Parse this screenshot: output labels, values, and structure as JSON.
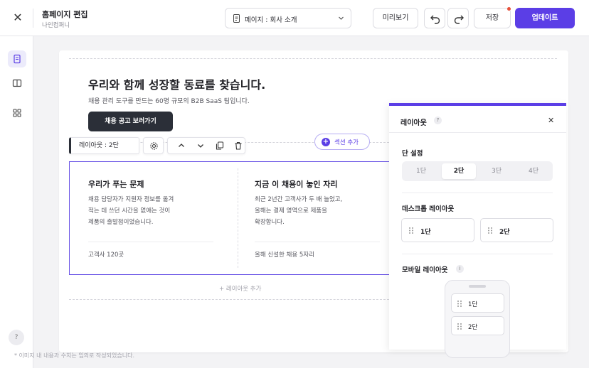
{
  "topbar": {
    "title": "홈페이지 편집",
    "subtitle": "나인컴퍼니",
    "page_select": "페이지 : 회사 소개",
    "preview": "미리보기",
    "save": "저장",
    "update": "업데이트"
  },
  "hero": {
    "title": "우리와 함께 성장할 동료를 찾습니다.",
    "desc": "채용 관리 도구를 만드는 60명 규모의 B2B SaaS 팀입니다.",
    "cta": "채용 공고 보러가기"
  },
  "add_section": "섹션 추가",
  "layout_label": "레이아웃 : 2단",
  "columns": [
    {
      "title": "우리가 푸는 문제",
      "lines": [
        "채용 담당자가 지원자 정보를 옮겨",
        "적는 데 쓰던 시간을 없애는 것이",
        "제품의 출발점이었습니다."
      ],
      "footer": "고객사 120곳"
    },
    {
      "title": "지금 이 채용이 놓인 자리",
      "lines": [
        "최근 2년간 고객사가 두 배 늘었고,",
        "올해는 결제 영역으로 제품을",
        "확장합니다."
      ],
      "footer": "올해 신설한 채용 5자리"
    }
  ],
  "add_layout": "+ 레이아웃 추가",
  "panel": {
    "title": "레이아웃",
    "help": "?",
    "close": "✕",
    "columns_label": "단 설정",
    "column_options": [
      "1단",
      "2단",
      "3단",
      "4단"
    ],
    "selected_column": "2단",
    "desktop_label": "데스크톱 레이아웃",
    "desktop_options": [
      "1단",
      "2단"
    ],
    "mobile_label": "모바일 레이아웃",
    "mobile_info": "i",
    "mobile_options": [
      "1단",
      "2단"
    ]
  },
  "rail": {
    "help": "?"
  },
  "footnote": "* 이미지 내 내용과 수치는 임의로 작성되었습니다.",
  "colors": {
    "accent": "#5b3ee6",
    "dark": "#2b2f38",
    "badge": "#e8503a"
  },
  "icons": [
    "close-icon",
    "document-icon",
    "chevron-down-icon",
    "undo-icon",
    "redo-icon",
    "page-icon",
    "columns-icon",
    "grid-icon",
    "gear-icon",
    "arrow-up-icon",
    "arrow-down-icon",
    "copy-icon",
    "trash-icon",
    "drag-handle-icon"
  ]
}
